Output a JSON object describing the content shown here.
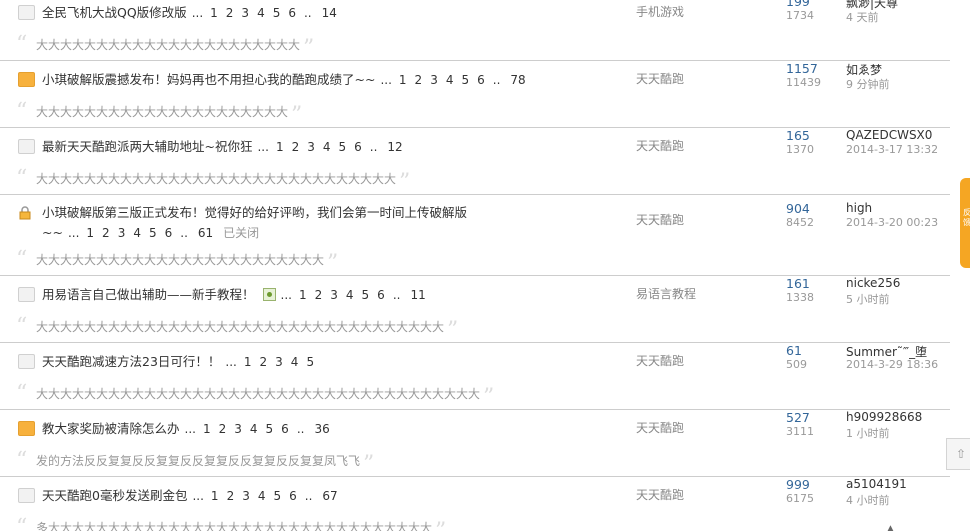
{
  "threads": [
    {
      "icon": "common",
      "title": "全民飞机大战QQ版修改版",
      "pages": [
        "1",
        "2",
        "3",
        "4",
        "5",
        "6"
      ],
      "last_page": "14",
      "forum": "手机游戏",
      "replies": "199",
      "views": "1734",
      "author": "飘渺|天尊",
      "time": "4 天前",
      "summary": "大大大大大大大大大大大大大大大大大大大大大大"
    },
    {
      "icon": "hot",
      "title": "小琪破解版震撼发布！妈妈再也不用担心我的酷跑成绩了~~",
      "pages": [
        "1",
        "2",
        "3",
        "4",
        "5",
        "6"
      ],
      "last_page": "78",
      "forum": "天天酷跑",
      "replies": "1157",
      "views": "11439",
      "author": "如ゑ梦",
      "time": "9 分钟前",
      "summary": "大大大大大大大大大大大大大大大大大大大大大"
    },
    {
      "icon": "common",
      "title": "最新天天酷跑派两大辅助地址~祝你狂",
      "pages": [
        "1",
        "2",
        "3",
        "4",
        "5",
        "6"
      ],
      "last_page": "12",
      "forum": "天天酷跑",
      "replies": "165",
      "views": "1370",
      "author": "QAZEDCWSX0",
      "time": "2014-3-17 13:32",
      "summary": "大大大大大大大大大大大大大大大大大大大大大大大大大大大大大大"
    },
    {
      "icon": "lock",
      "title": "小琪破解版第三版正式发布！觉得好的给好评哟，我们会第一时间上传破解版~~",
      "pages": [
        "1",
        "2",
        "3",
        "4",
        "5",
        "6"
      ],
      "last_page": "61",
      "closed": "已关闭",
      "forum": "天天酷跑",
      "replies": "904",
      "views": "8452",
      "author": "high",
      "time": "2014-3-20 00:23",
      "summary": "大大大大大大大大大大大大大大大大大大大大大大大大"
    },
    {
      "icon": "common",
      "title": "用易语言自己做出辅助——新手教程！",
      "has_image": true,
      "pages": [
        "1",
        "2",
        "3",
        "4",
        "5",
        "6"
      ],
      "last_page": "11",
      "forum": "易语言教程",
      "replies": "161",
      "views": "1338",
      "author": "nicke256",
      "time": "5 小时前",
      "summary": "大大大大大大大大大大大大大大大大大大大大大大大大大大大大大大大大大大"
    },
    {
      "icon": "common",
      "title": "天天酷跑减速方法23日可行！！",
      "pages": [
        "1",
        "2",
        "3",
        "4",
        "5"
      ],
      "last_page": "",
      "forum": "天天酷跑",
      "replies": "61",
      "views": "509",
      "author": "Summer˜‴_堕",
      "time": "2014-3-29 18:36",
      "summary": "大大大大大大大大大大大大大大大大大大大大大大大大大大大大大大大大大大大大大"
    },
    {
      "icon": "hot",
      "title": "教大家奖励被清除怎么办",
      "pages": [
        "1",
        "2",
        "3",
        "4",
        "5",
        "6"
      ],
      "last_page": "36",
      "forum": "天天酷跑",
      "replies": "527",
      "views": "3111",
      "author": "h909928668",
      "time": "1 小时前",
      "summary": "发的方法反反复复反反复复反反复复反反复复反反复复凤飞飞"
    },
    {
      "icon": "common",
      "title": "天天酷跑0毫秒发送刷金包",
      "pages": [
        "1",
        "2",
        "3",
        "4",
        "5",
        "6"
      ],
      "last_page": "67",
      "forum": "天天酷跑",
      "replies": "999",
      "views": "6175",
      "author": "a5104191",
      "time": "4 小时前",
      "summary": "多大大大大大大大大大大大大大大大大大大大大大大大大大大大大大大大大"
    }
  ],
  "ui": {
    "ellipsis": "...",
    "page_ellipsis": "..",
    "open_quote": "“",
    "close_quote": "”",
    "scroll_tab_label": "反馈",
    "gotop_icon": "up-arrow-icon",
    "colors": {
      "accent": "#336699",
      "hot_icon": "#f7b13d",
      "side_tab": "#f5a623"
    }
  }
}
